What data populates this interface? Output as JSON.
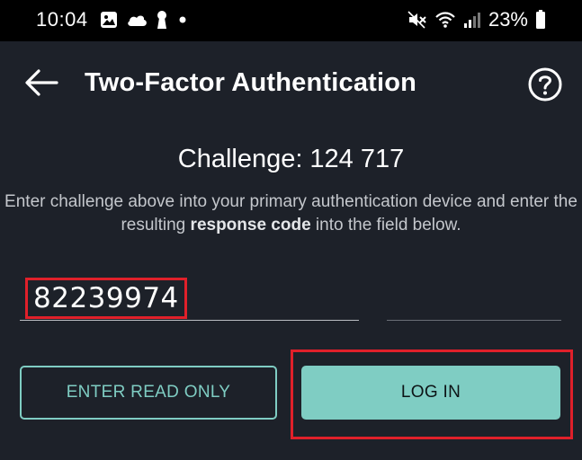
{
  "status_bar": {
    "time": "10:04",
    "left_icons": [
      "image-icon",
      "cloud-icon",
      "keyhole-icon",
      "dot-icon"
    ],
    "right_icons": [
      "mute-icon",
      "wifi-icon",
      "signal-icon",
      "battery-icon"
    ],
    "battery_percent": "23%"
  },
  "app_bar": {
    "back_icon": "arrow-left-icon",
    "title": "Two-Factor Authentication",
    "help_icon": "question-circle-icon"
  },
  "challenge": {
    "label": "Challenge:",
    "code": "124 717"
  },
  "instructions": {
    "before_bold": "Enter challenge above into your primary authentication device and enter the resulting ",
    "bold": "response code",
    "after_bold": " into the field below."
  },
  "response_field": {
    "value": "82239974"
  },
  "buttons": {
    "enter_read_only": "ENTER READ ONLY",
    "log_in": "LOG IN"
  },
  "colors": {
    "background": "#1d2129",
    "status_bar": "#000000",
    "accent": "#7fcdc3",
    "highlight": "#e0202a"
  }
}
